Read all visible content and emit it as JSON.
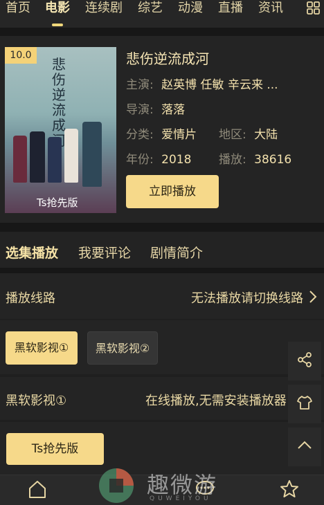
{
  "nav": {
    "tabs": [
      "首页",
      "电影",
      "连续剧",
      "综艺",
      "动漫",
      "直播",
      "资讯"
    ],
    "active": "电影"
  },
  "movie": {
    "rating": "10.0",
    "title": "悲伤逆流成河",
    "poster_title": "悲伤逆流成河",
    "poster_tag": "Ts抢先版",
    "cast_label": "主演:",
    "cast": "赵英博  任敏  辛云来 ...",
    "director_label": "导演:",
    "director": "落落",
    "genre_label": "分类:",
    "genre": "爱情片",
    "region_label": "地区:",
    "region": "大陆",
    "year_label": "年份:",
    "year": "2018",
    "plays_label": "播放:",
    "plays": "38616",
    "play_button": "立即播放"
  },
  "subtabs": [
    "选集播放",
    "我要评论",
    "剧情简介"
  ],
  "line": {
    "label": "播放线路",
    "hint": "无法播放请切换线路"
  },
  "sources": [
    "黑软影视①",
    "黑软影视②"
  ],
  "episode_row": {
    "name": "黑软影视①",
    "desc": "在线播放,无需安装播放器"
  },
  "episodes": [
    "Ts抢先版"
  ],
  "watermark": {
    "text": "趣微游",
    "sub": "QUWEIYOU"
  },
  "colors": {
    "accent": "#f6d98a",
    "background": "#1f1f1f",
    "text": "#e8d7a3"
  },
  "icons": {
    "share": "share-icon",
    "shirt": "shirt-icon",
    "collapse": "chevron-up-icon",
    "home": "home-icon",
    "chat": "chat-icon",
    "star": "star-icon",
    "grid": "grid-icon"
  }
}
